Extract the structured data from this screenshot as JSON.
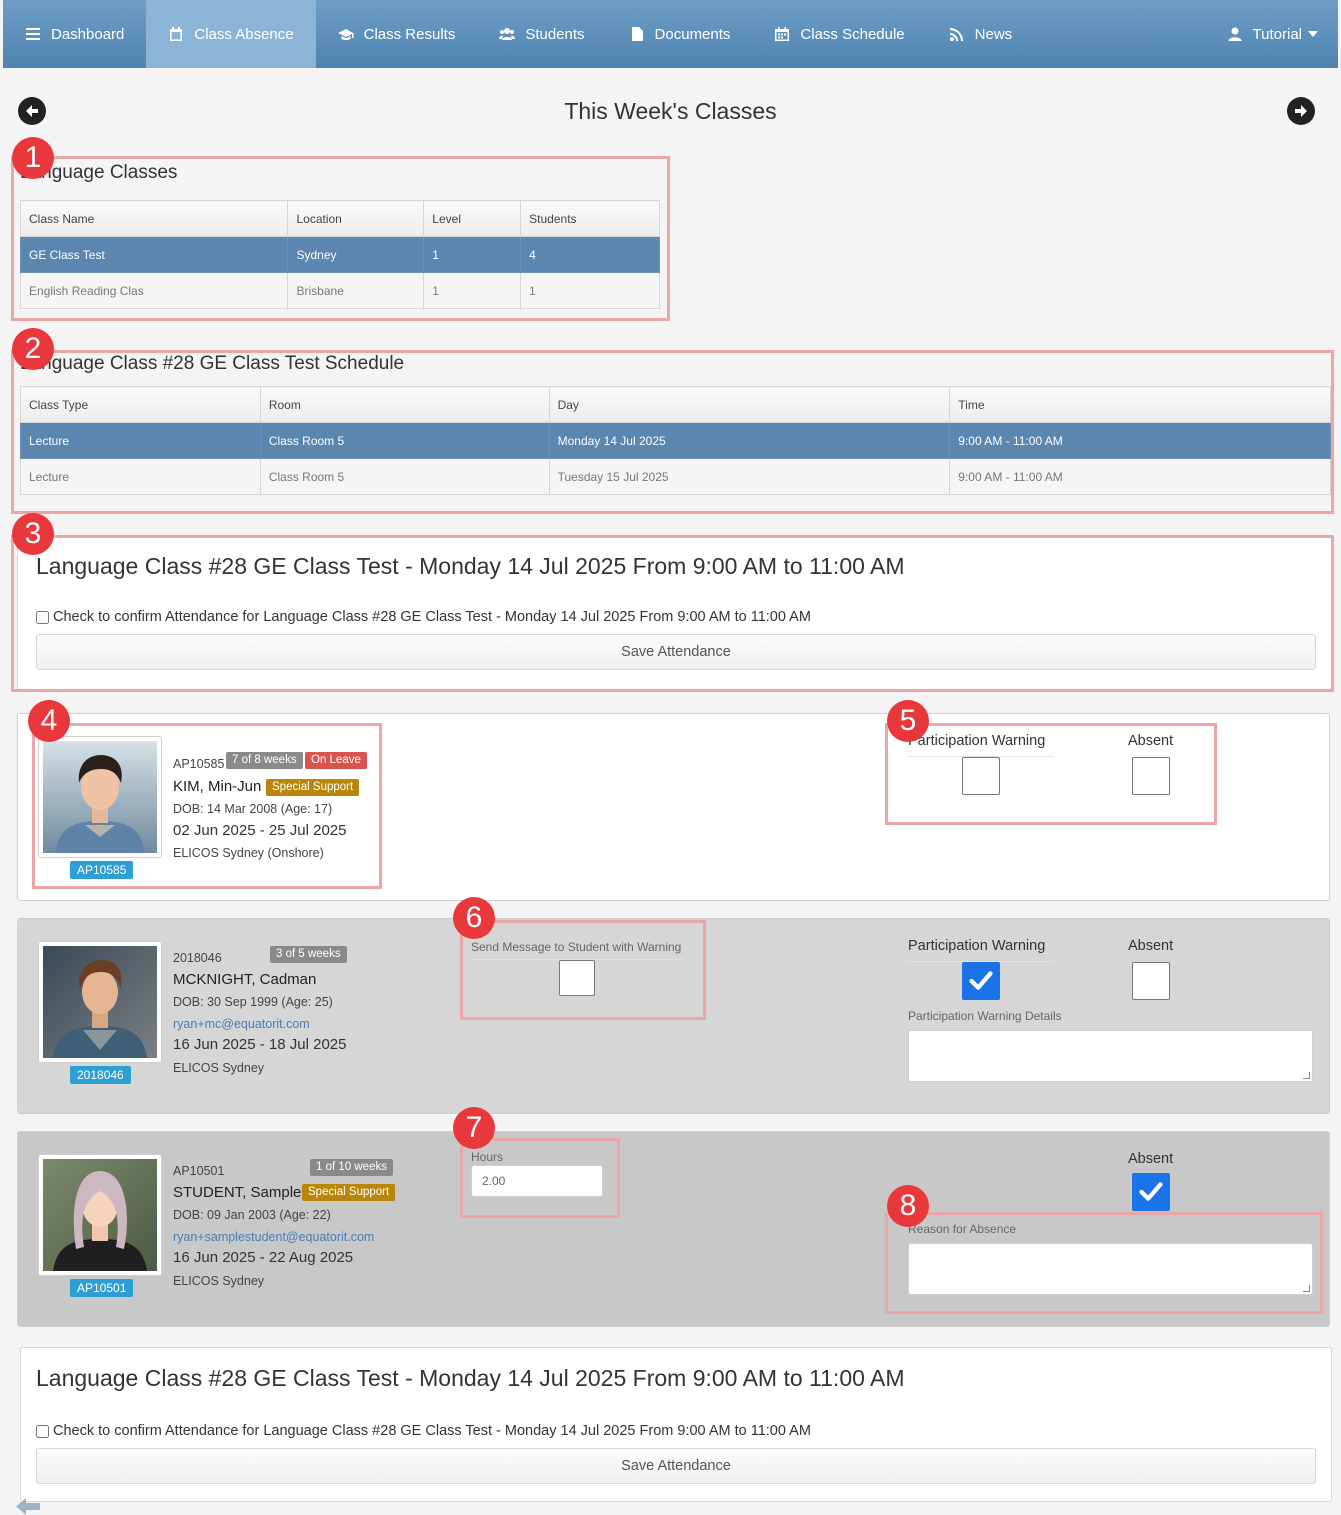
{
  "nav": {
    "items": [
      {
        "label": "Dashboard",
        "icon": "dashboard-icon"
      },
      {
        "label": "Class Absence",
        "icon": "calendar-icon"
      },
      {
        "label": "Class Results",
        "icon": "graduation-cap-icon"
      },
      {
        "label": "Students",
        "icon": "users-icon"
      },
      {
        "label": "Documents",
        "icon": "document-icon"
      },
      {
        "label": "Class Schedule",
        "icon": "calendar-grid-icon"
      },
      {
        "label": "News",
        "icon": "rss-icon"
      }
    ],
    "active_index": 1,
    "user": "Tutorial"
  },
  "week_title": "This Week's Classes",
  "language_classes": {
    "title": "Language Classes",
    "headers": [
      "Class Name",
      "Location",
      "Level",
      "Students"
    ],
    "rows": [
      [
        "GE Class Test",
        "Sydney",
        "1",
        "4"
      ],
      [
        "English Reading Clas",
        "Brisbane",
        "1",
        "1"
      ]
    ]
  },
  "schedule": {
    "title": "Language Class #28 GE Class Test Schedule",
    "headers": [
      "Class Type",
      "Room",
      "Day",
      "Time"
    ],
    "rows": [
      [
        "Lecture",
        "Class Room 5",
        "Monday 14 Jul 2025",
        "9:00 AM - 11:00 AM"
      ],
      [
        "Lecture",
        "Class Room 5",
        "Tuesday 15 Jul 2025",
        "9:00 AM - 11:00 AM"
      ]
    ]
  },
  "attendance": {
    "heading": "Language Class #28 GE Class Test - Monday 14 Jul 2025 From 9:00 AM to 11:00 AM",
    "confirm_label": "Check to confirm Attendance for Language Class #28 GE Class Test - Monday 14 Jul 2025 From 9:00 AM to 11:00 AM",
    "save_label": "Save Attendance"
  },
  "students": [
    {
      "id": "AP10585",
      "weeks": "7 of 8 weeks",
      "status": "On Leave",
      "name": "KIM, Min-Jun",
      "tag": "Special Support",
      "dob": "DOB: 14 Mar 2008 (Age: 17)",
      "dates": "02 Jun 2025 - 25 Jul 2025",
      "campus": "ELICOS Sydney (Onshore)",
      "participation_label": "Participation Warning",
      "absent_label": "Absent",
      "participation_warning": false,
      "absent": false
    },
    {
      "id": "2018046",
      "weeks": "3 of 5 weeks",
      "name": "MCKNIGHT, Cadman",
      "dob": "DOB: 30 Sep 1999 (Age: 25)",
      "email": "ryan+mc@equatorit.com",
      "dates": "16 Jun 2025 - 18 Jul 2025",
      "campus": "ELICOS Sydney",
      "send_message_label": "Send Message to Student with Warning",
      "participation_label": "Participation Warning",
      "absent_label": "Absent",
      "details_label": "Participation Warning Details",
      "participation_warning": true,
      "absent": false
    },
    {
      "id": "AP10501",
      "weeks": "1 of 10 weeks",
      "name": "STUDENT, Sample",
      "tag": "Special Support",
      "dob": "DOB: 09 Jan 2003 (Age: 22)",
      "email": "ryan+samplestudent@equatorit.com",
      "dates": "16 Jun 2025 - 22 Aug 2025",
      "campus": "ELICOS Sydney",
      "hours_label": "Hours",
      "hours_value": "2.00",
      "absent_label": "Absent",
      "reason_label": "Reason for Absence",
      "absent": true
    }
  ],
  "markers": [
    "1",
    "2",
    "3",
    "4",
    "5",
    "6",
    "7",
    "8"
  ],
  "colors": {
    "nav": "#5a8dba",
    "selected_row": "#5a86b0",
    "badge": "#2d9fd2",
    "marker": "#e8383b",
    "highlight": "#eba6a6",
    "check": "#1a73e8"
  }
}
